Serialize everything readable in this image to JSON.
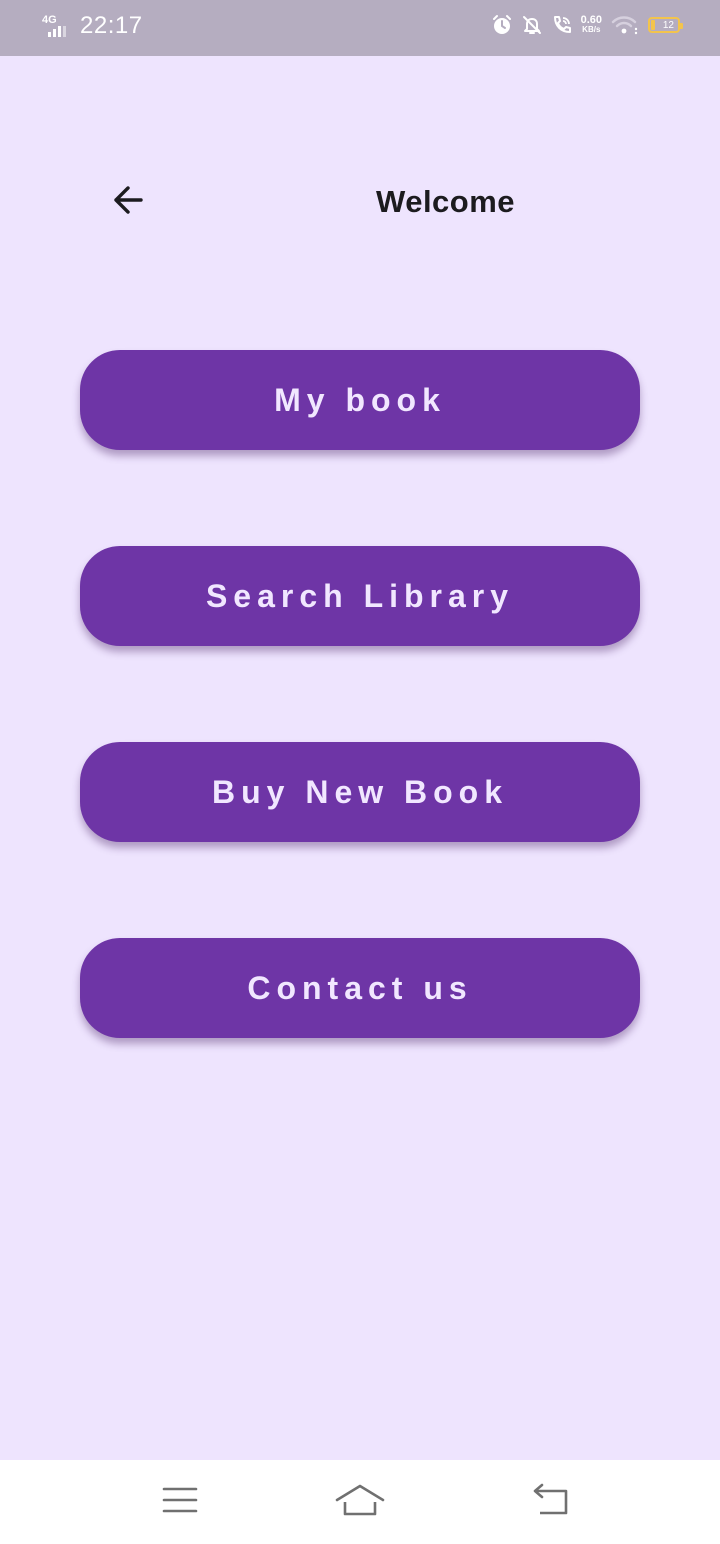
{
  "status_bar": {
    "network_type": "4G",
    "time": "22:17",
    "net_speed_value": "0.60",
    "net_speed_unit": "KB/s",
    "battery_level": "12",
    "icons": [
      "alarm-icon",
      "notifications-off-icon",
      "wifi-calling-icon",
      "wifi-icon",
      "battery-icon"
    ]
  },
  "app_bar": {
    "title": "Welcome",
    "back_icon": "arrow-back-icon"
  },
  "menu": {
    "my_book": "My book",
    "search_library": "Search Library",
    "buy_new_book": "Buy New Book",
    "contact_us": "Contact us"
  },
  "nav_bar": {
    "icons": [
      "menu-icon",
      "home-icon",
      "back-icon"
    ]
  },
  "colors": {
    "background": "#EEE4FE",
    "button": "#6E35A6",
    "button_text": "#F1E7FF",
    "status_bar": "#B5ADC0",
    "battery_low": "#F3C44C"
  }
}
